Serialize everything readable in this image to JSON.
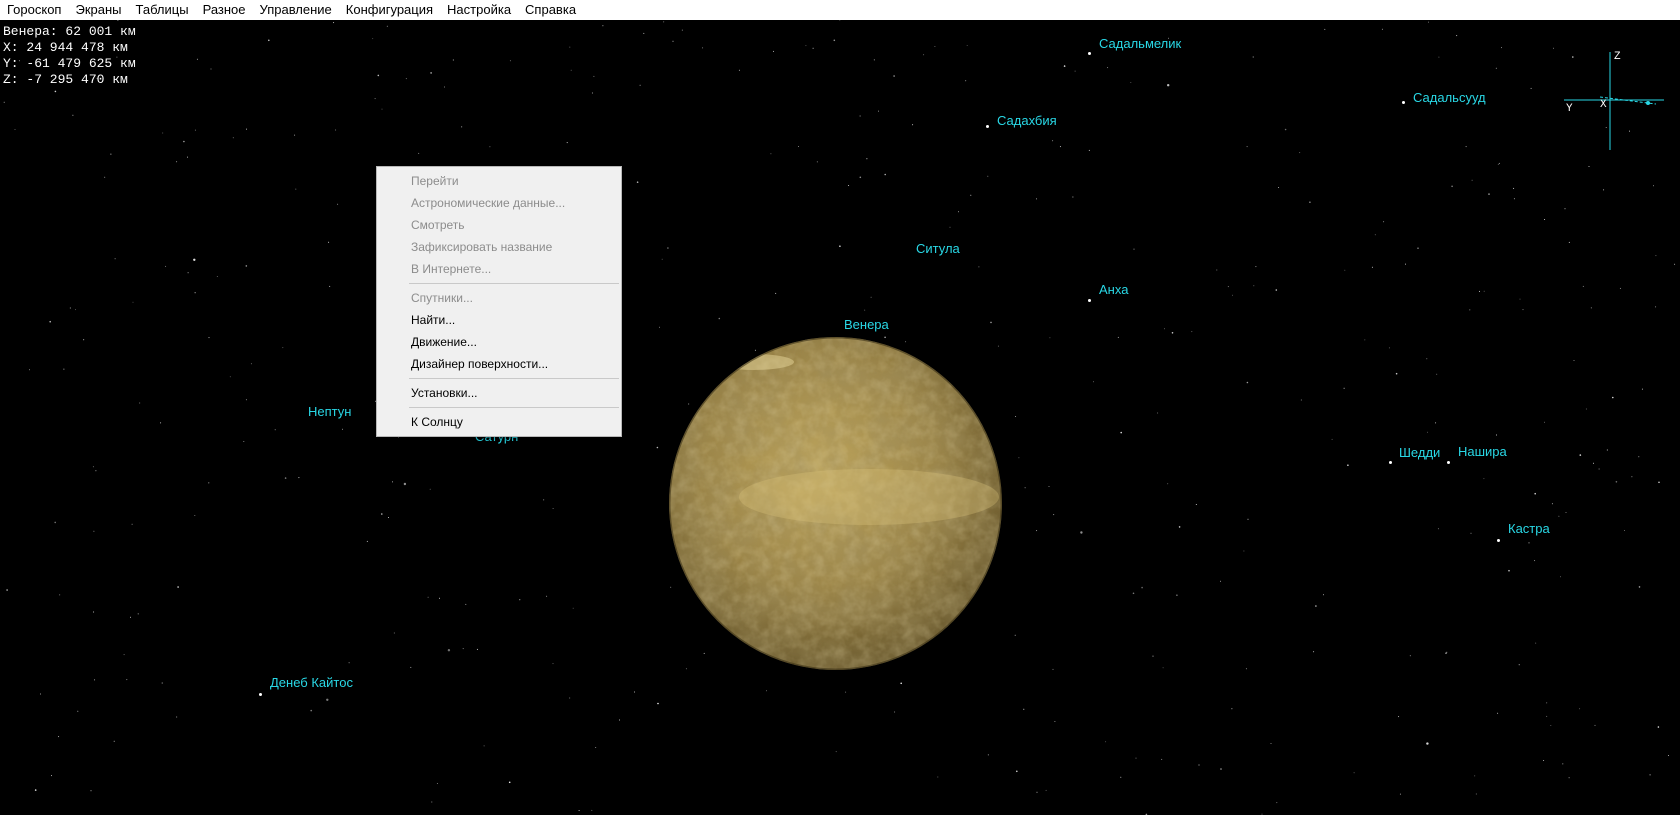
{
  "menubar": {
    "items": [
      "Гороскоп",
      "Экраны",
      "Таблицы",
      "Разное",
      "Управление",
      "Конфигурация",
      "Настройка",
      "Справка"
    ]
  },
  "readout": {
    "line1": "Венера: 62 001 км",
    "line2": "X: 24 944 478 км",
    "line3": "Y: -61 479 625 км",
    "line4": "Z: -7 295 470 км"
  },
  "labels": {
    "sadalmelik": "Садальмелик",
    "sadalsuud": "Садальсууд",
    "sadachbia": "Садахбия",
    "situla": "Ситула",
    "ankha": "Анха",
    "venus": "Венера",
    "neptune": "Нептун",
    "saturn": "Сатурн",
    "sheddi": "Шедди",
    "nashira": "Нашира",
    "kastra": "Кастра",
    "deneb_algedi": "Денеб Кайтос"
  },
  "context_menu": {
    "goto": "Перейти",
    "astro_data": "Астрономические данные...",
    "view": "Смотреть",
    "fix_name": "Зафиксировать название",
    "internet": "В Интернете...",
    "satellites": "Спутники...",
    "find": "Найти...",
    "motion": "Движение...",
    "surface_designer": "Дизайнер поверхности...",
    "settings": "Установки...",
    "to_sun": "К Солнцу"
  },
  "axes": {
    "z": "Z",
    "y": "Y",
    "x": "X"
  },
  "colors": {
    "label": "#29d8e6",
    "planet": "#a8904a",
    "menu_bg": "#f0f0f0"
  }
}
